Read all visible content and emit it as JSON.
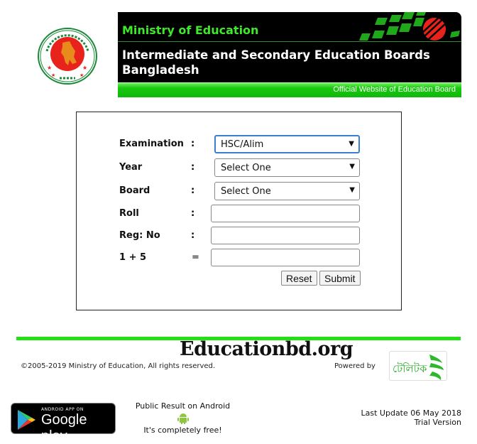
{
  "header": {
    "ministry": "Ministry of Education",
    "title": "Intermediate and Secondary Education Boards Bangladesh",
    "title_line1": "Intermediate and Secondary Education Boards",
    "title_line2": "Bangladesh",
    "tagline": "Official Website of Education Board",
    "logo_icon": "government-seal-icon"
  },
  "form": {
    "fields": [
      {
        "label": "Examination",
        "sep": ":",
        "type": "select",
        "value": "HSC/Alim"
      },
      {
        "label": "Year",
        "sep": ":",
        "type": "select",
        "value": "Select One"
      },
      {
        "label": "Board",
        "sep": ":",
        "type": "select",
        "value": "Select One"
      },
      {
        "label": "Roll",
        "sep": ":",
        "type": "text",
        "value": ""
      },
      {
        "label": "Reg: No",
        "sep": ":",
        "type": "text",
        "value": ""
      },
      {
        "label": "1 + 5",
        "sep": "=",
        "type": "text",
        "value": ""
      }
    ],
    "dropdown_arrow": "▼",
    "reset_label": "Reset",
    "submit_label": "Submit"
  },
  "footer": {
    "brand": "Educationbd.org",
    "copyright": "©2005-2019 Ministry of Education, All rights reserved.",
    "powered_by": "Powered by",
    "powered_logo_text": "টেলিটক",
    "google_play_small": "ANDROID APP ON",
    "google_play_big": "Google play",
    "android_line1": "Public Result on Android",
    "android_line2": "It's completely free!",
    "last_update": "Last Update 06 May 2018",
    "version": "Trial Version"
  },
  "colors": {
    "ministry_green": "#3ee82a",
    "bar_green": "#22e012",
    "focus_blue": "#3c7fd1"
  }
}
